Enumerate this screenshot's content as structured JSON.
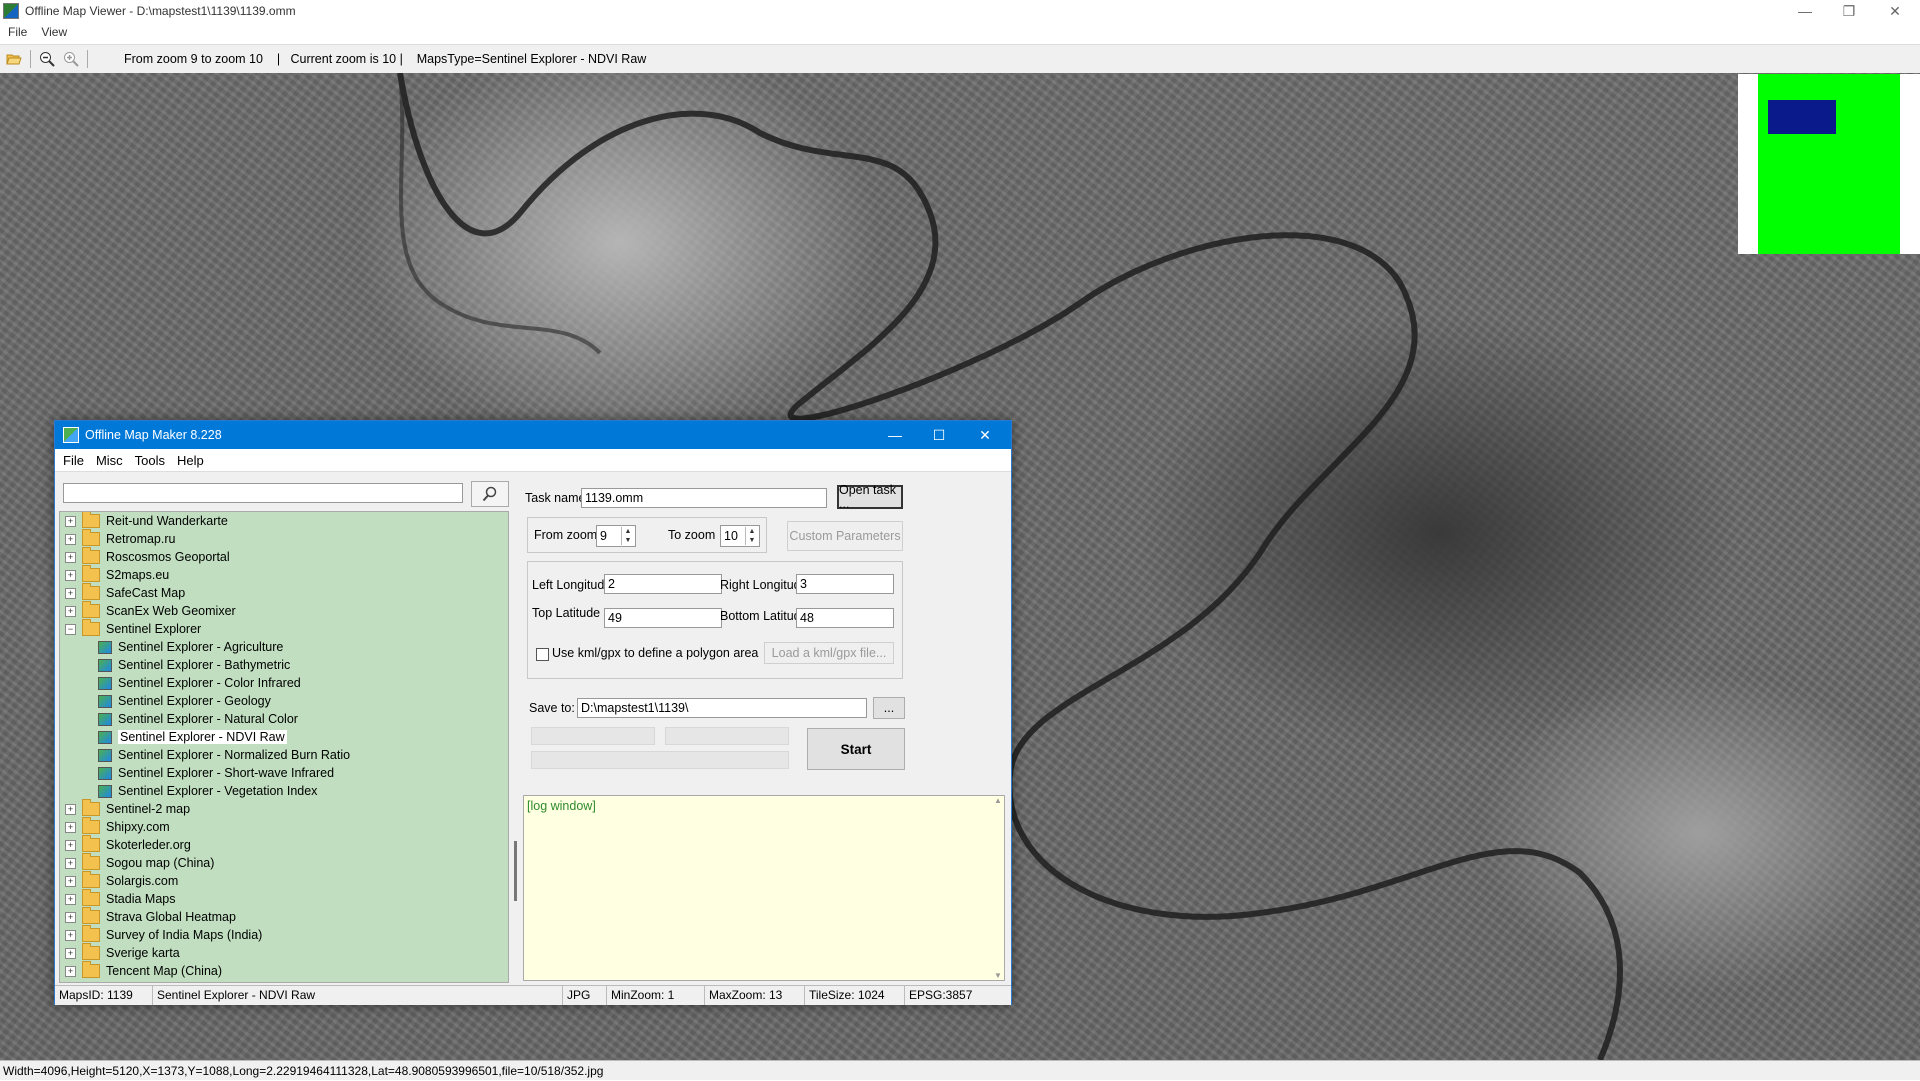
{
  "window": {
    "title": "Offline Map Viewer - D:\\mapstest1\\1139\\1139.omm",
    "minimize": "—",
    "maximize": "❐",
    "close": "✕"
  },
  "menu": [
    "File",
    "View"
  ],
  "toolbar": {
    "icons": [
      "open-folder-icon",
      "zoom-out-icon",
      "zoom-in-icon"
    ],
    "info": "From zoom 9 to zoom 10    |   Current zoom is 10 |    MapsType=Sentinel Explorer - NDVI Raw"
  },
  "status_bar": "Width=4096,Height=5120,X=1373,Y=1088,Long=2.22919464111328,Lat=48.9080593996501,file=10/518/352.jpg",
  "minimap": {
    "background": "#00ff00",
    "viewport": "#0b1a8a"
  },
  "dialog": {
    "title": "Offline Map Maker 8.228",
    "menu": [
      "File",
      "Misc",
      "Tools",
      "Help"
    ],
    "search_placeholder": "",
    "tree": [
      {
        "type": "folder",
        "label": "Reit-und Wanderkarte",
        "expander": "+"
      },
      {
        "type": "folder",
        "label": "Retromap.ru",
        "expander": "+"
      },
      {
        "type": "folder",
        "label": "Roscosmos Geoportal",
        "expander": "+"
      },
      {
        "type": "folder",
        "label": "S2maps.eu",
        "expander": "+"
      },
      {
        "type": "folder",
        "label": "SafeCast Map",
        "expander": "+"
      },
      {
        "type": "folder",
        "label": "ScanEx Web Geomixer",
        "expander": "+"
      },
      {
        "type": "folder",
        "label": "Sentinel Explorer",
        "expander": "−",
        "open": true
      },
      {
        "type": "leaf",
        "label": "Sentinel Explorer - Agriculture"
      },
      {
        "type": "leaf",
        "label": "Sentinel Explorer - Bathymetric"
      },
      {
        "type": "leaf",
        "label": "Sentinel Explorer - Color Infrared"
      },
      {
        "type": "leaf",
        "label": "Sentinel Explorer - Geology"
      },
      {
        "type": "leaf",
        "label": "Sentinel Explorer - Natural Color"
      },
      {
        "type": "leaf",
        "label": "Sentinel Explorer - NDVI Raw",
        "selected": true
      },
      {
        "type": "leaf",
        "label": "Sentinel Explorer - Normalized Burn Ratio"
      },
      {
        "type": "leaf",
        "label": "Sentinel Explorer - Short-wave Infrared"
      },
      {
        "type": "leaf",
        "label": "Sentinel Explorer - Vegetation Index"
      },
      {
        "type": "folder",
        "label": "Sentinel-2 map",
        "expander": "+"
      },
      {
        "type": "folder",
        "label": "Shipxy.com",
        "expander": "+"
      },
      {
        "type": "folder",
        "label": "Skoterleder.org",
        "expander": "+"
      },
      {
        "type": "folder",
        "label": "Sogou map (China)",
        "expander": "+"
      },
      {
        "type": "folder",
        "label": "Solargis.com",
        "expander": "+"
      },
      {
        "type": "folder",
        "label": "Stadia Maps",
        "expander": "+"
      },
      {
        "type": "folder",
        "label": "Strava Global Heatmap",
        "expander": "+"
      },
      {
        "type": "folder",
        "label": "Survey of India Maps (India)",
        "expander": "+"
      },
      {
        "type": "folder",
        "label": "Sverige karta",
        "expander": "+"
      },
      {
        "type": "folder",
        "label": "Tencent Map (China)",
        "expander": "+"
      }
    ],
    "task_name_label": "Task name",
    "task_name_value": "1139.omm",
    "open_task_label": "Open task ...",
    "from_zoom_label": "From zoom",
    "from_zoom_value": "9",
    "to_zoom_label": "To zoom",
    "to_zoom_value": "10",
    "custom_params_label": "Custom Parameters",
    "left_lon_label": "Left Longitude",
    "left_lon_value": "2",
    "right_lon_label": "Right Longitude",
    "right_lon_value": "3",
    "top_lat_label": "Top Latitude",
    "top_lat_value": "49",
    "bottom_lat_label": "Bottom Latitude",
    "bottom_lat_value": "48",
    "kml_label": "Use kml/gpx to define a polygon area",
    "load_kml_label": "Load a kml/gpx file...",
    "save_to_label": "Save to:",
    "save_to_value": "D:\\mapstest1\\1139\\",
    "browse_label": "...",
    "start_label": "Start",
    "log_text": "[log window]",
    "status": {
      "maps_id": "MapsID: 1139",
      "maps_name": "Sentinel Explorer - NDVI Raw",
      "format": "JPG",
      "min_zoom": "MinZoom: 1",
      "max_zoom": "MaxZoom: 13",
      "tile_size": "TileSize: 1024",
      "epsg": "EPSG:3857"
    }
  }
}
